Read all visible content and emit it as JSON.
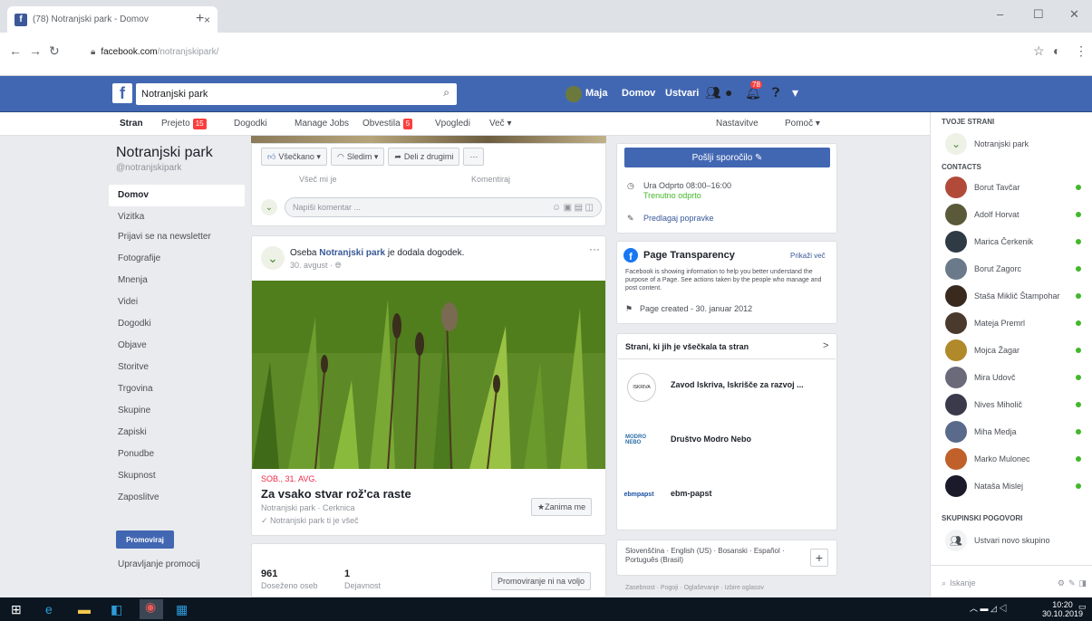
{
  "browser": {
    "tab_title": "(78) Notranjski park - Domov",
    "tab_close": "×",
    "new_tab": "+",
    "url_host": "facebook.com",
    "url_path": "/notranjskipark/",
    "win_min": "–",
    "win_max": "☐",
    "win_close": "✕"
  },
  "fb": {
    "logo": "f",
    "search_value": "Notranjski park",
    "profile_name": "Maja",
    "nav_home": "Domov",
    "nav_create": "Ustvari",
    "notif_count": "78"
  },
  "page_tabs": [
    "Stran",
    "Prejeto",
    "Dogodki",
    "Manage Jobs",
    "Obvestila",
    "Vpogledi",
    "Več ▾",
    "Nastavitve",
    "Pomoč ▾"
  ],
  "page_tab_badges": {
    "prejeto": "15",
    "obvestila": "5"
  },
  "left_nav": {
    "page_name": "Notranjski park",
    "handle": "@notranjskipark",
    "items": [
      "Domov",
      "Vizitka",
      "Prijavi se na newsletter",
      "Fotografije",
      "Mnenja",
      "Videi",
      "Dogodki",
      "Objave",
      "Storitve",
      "Trgovina",
      "Skupine",
      "Zapiski",
      "Ponudbe",
      "Skupnost",
      "Zaposlitve"
    ],
    "promote_label": "Promoviraj",
    "manage_promos": "Upravljanje promocij"
  },
  "feed": {
    "react_pills": [
      "Všečkano ▾",
      "Sledim ▾",
      "Deli z drugimi",
      "···"
    ],
    "partial_left": "Všeč mi je",
    "partial_right": "Komentiraj",
    "comment_placeholder": "Napiši komentar ...",
    "post": {
      "prefix": "Oseba ",
      "author": "Notranjski park",
      "suffix": " je dodala dogodek.",
      "date": "30. avgust",
      "menu": "···"
    },
    "event": {
      "date": "SOB., 31. AVG.",
      "title": "Za vsako stvar rož'ca raste",
      "location": "Notranjski park · Cerknica",
      "going": "Notranjski park ti je všeč",
      "interested": "Zanima me"
    },
    "stats": {
      "reach": "961",
      "reach_label": "Doseženo oseb",
      "engagement": "1",
      "engagement_label": "Dejavnost",
      "boost": "Promoviranje ni na voljo"
    }
  },
  "right": {
    "send_message": "Pošlji sporočilo ✎",
    "hours": "Ura Odprto 08:00–16:00",
    "hours_status": "Trenutno odprto",
    "suggest_edits": "Predlagaj popravke",
    "transparency_title": "Page Transparency",
    "transparency_more": "Prikaži več",
    "transparency_body": "Facebook is showing information to help you better understand the purpose of a Page. See actions taken by the people who manage and post content.",
    "page_created": "Page created - 30. januar 2012",
    "liked_pages_title": "Strani, ki jih je všečkala ta stran",
    "liked_pages_arrow": ">",
    "liked_pages": [
      "Zavod Iskriva, Iskrišče za razvoj ...",
      "Društvo Modro Nebo",
      "ebm-papst"
    ],
    "logo_labels": [
      "ISKRIVA",
      "MODRO NEBO",
      "ebmpapst"
    ],
    "languages": "Slovenščina · English (US) · Bosanski · Español · Português (Brasil)",
    "lang_add": "+",
    "footer_hint": "Zasebnost · Pogoji · Oglaševanje · Izbire oglasov"
  },
  "chat": {
    "your_pages": "TVOJE STRANI",
    "page_entry": "Notranjski park",
    "contacts_title": "CONTACTS",
    "contacts": [
      "Borut Tavčar",
      "Adolf Horvat",
      "Marica Čerkenik",
      "Borut Zagorc",
      "Staša Miklič Štampohar",
      "Mateja Premrl",
      "Mojca Žagar",
      "Mira Udovč",
      "Nives Miholič",
      "Miha Medja",
      "Marko Mulonec",
      "Nataša Mislej"
    ],
    "group_title": "SKUPINSKI POGOVORI",
    "create_group": "Ustvari novo skupino",
    "search_placeholder": "Iskanje"
  },
  "taskbar": {
    "time": "10:20",
    "date": "30.10.2019"
  },
  "colors": {
    "fb_blue": "#4267b2",
    "online_green": "#42b72a",
    "badge_red": "#fa3e3e"
  }
}
